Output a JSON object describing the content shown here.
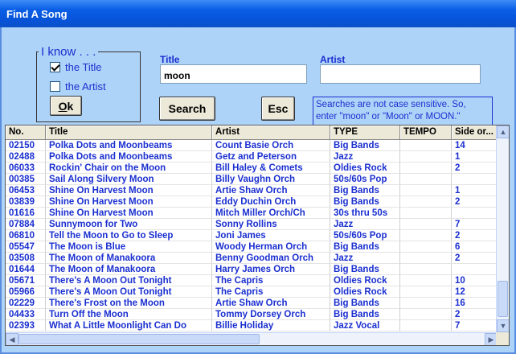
{
  "window": {
    "title": "Find A Song"
  },
  "iknow": {
    "legend": "I know . . .",
    "options": [
      {
        "label": "the Title",
        "checked": true
      },
      {
        "label": "the Artist",
        "checked": false
      }
    ],
    "ok_label": "Ok",
    "ok_mnemonic": "O"
  },
  "search": {
    "title_label": "Title",
    "title_value": "moon",
    "artist_label": "Artist",
    "artist_value": "",
    "search_button": "Search",
    "esc_button": "Esc",
    "note": "Searches are not case sensitive. So, enter \"moon\" or \"Moon\" or MOON.\""
  },
  "table": {
    "columns": [
      "No.",
      "Title",
      "Artist",
      "TYPE",
      "TEMPO",
      "Side or..."
    ],
    "rows": [
      [
        "02150",
        "Polka Dots and Moonbeams",
        "Count Basie Orch",
        "Big Bands",
        "",
        "14"
      ],
      [
        "02488",
        "Polka Dots and Moonbeams",
        "Getz and Peterson",
        "Jazz",
        "",
        "1"
      ],
      [
        "06033",
        "Rockin' Chair on the Moon",
        "Bill Haley & Comets",
        "Oldies Rock",
        "",
        "2"
      ],
      [
        "00385",
        "Sail Along Silvery Moon",
        "Billy Vaughn Orch",
        "50s/60s Pop",
        "",
        ""
      ],
      [
        "06453",
        "Shine On Harvest Moon",
        "Artie Shaw Orch",
        "Big Bands",
        "",
        "1"
      ],
      [
        "03839",
        "Shine On Harvest Moon",
        "Eddy Duchin Orch",
        "Big Bands",
        "",
        "2"
      ],
      [
        "01616",
        "Shine On Harvest Moon",
        "Mitch Miller Orch/Ch",
        "30s thru 50s",
        "",
        ""
      ],
      [
        "07884",
        "Sunnymoon for Two",
        "Sonny Rollins",
        "Jazz",
        "",
        "7"
      ],
      [
        "06810",
        "Tell the Moon to Go to Sleep",
        "Joni James",
        "50s/60s Pop",
        "",
        "2"
      ],
      [
        "05547",
        "The Moon is Blue",
        "Woody Herman Orch",
        "Big Bands",
        "",
        "6"
      ],
      [
        "03508",
        "The Moon of Manakoora",
        "Benny Goodman Orch",
        "Jazz",
        "",
        "2"
      ],
      [
        "01644",
        "The Moon of Manakoora",
        "Harry James Orch",
        "Big Bands",
        "",
        ""
      ],
      [
        "05671",
        "There's A Moon Out Tonight",
        "The Capris",
        "Oldies Rock",
        "",
        "10"
      ],
      [
        "05966",
        "There's A Moon Out Tonight",
        "The Capris",
        "Oldies Rock",
        "",
        "12"
      ],
      [
        "02229",
        "There's Frost on the Moon",
        "Artie Shaw Orch",
        "Big Bands",
        "",
        "16"
      ],
      [
        "04433",
        "Turn Off the Moon",
        "Tommy Dorsey Orch",
        "Big Bands",
        "",
        "2"
      ],
      [
        "02393",
        "What A Little Moonlight Can Do",
        "Billie Holiday",
        "Jazz Vocal",
        "",
        "7"
      ]
    ]
  },
  "icons": {
    "scroll_up": "▲",
    "scroll_down": "▼",
    "scroll_left": "◀",
    "scroll_right": "▶"
  }
}
